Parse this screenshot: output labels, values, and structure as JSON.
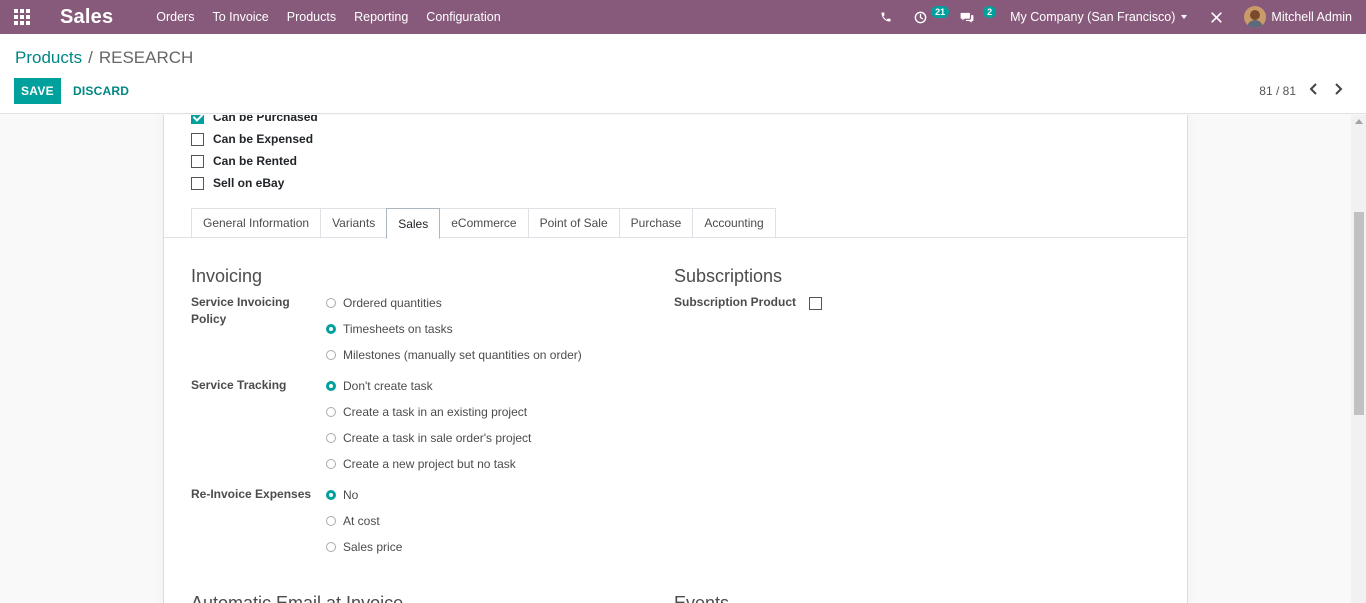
{
  "navbar": {
    "app_name": "Sales",
    "menu": [
      "Orders",
      "To Invoice",
      "Products",
      "Reporting",
      "Configuration"
    ],
    "activity_count": "21",
    "messages_count": "2",
    "company": "My Company (San Francisco)",
    "user": "Mitchell Admin",
    "colors": {
      "bar": "#875a7b",
      "badge": "#00a09d"
    }
  },
  "breadcrumb": {
    "parent": "Products",
    "current": "RESEARCH"
  },
  "actions": {
    "save": "SAVE",
    "discard": "DISCARD"
  },
  "pager": {
    "value": "81 / 81"
  },
  "options": [
    {
      "label": "Can be Purchased",
      "checked": true
    },
    {
      "label": "Can be Expensed",
      "checked": false
    },
    {
      "label": "Can be Rented",
      "checked": false
    },
    {
      "label": "Sell on eBay",
      "checked": false
    }
  ],
  "tabs": [
    "General Information",
    "Variants",
    "Sales",
    "eCommerce",
    "Point of Sale",
    "Purchase",
    "Accounting"
  ],
  "active_tab": "Sales",
  "invoicing": {
    "title": "Invoicing",
    "service_invoicing_policy": {
      "label": "Service Invoicing Policy",
      "options": [
        "Ordered quantities",
        "Timesheets on tasks",
        "Milestones (manually set quantities on order)"
      ],
      "selected": "Timesheets on tasks"
    },
    "service_tracking": {
      "label": "Service Tracking",
      "options": [
        "Don't create task",
        "Create a task in an existing project",
        "Create a task in sale order's project",
        "Create a new project but no task"
      ],
      "selected": "Don't create task"
    },
    "reinvoice_expenses": {
      "label": "Re-Invoice Expenses",
      "options": [
        "No",
        "At cost",
        "Sales price"
      ],
      "selected": "No"
    }
  },
  "subscriptions": {
    "title": "Subscriptions",
    "subscription_product": {
      "label": "Subscription Product",
      "checked": false
    }
  },
  "lower_sections": {
    "left": "Automatic Email at Invoice",
    "right": "Events"
  }
}
